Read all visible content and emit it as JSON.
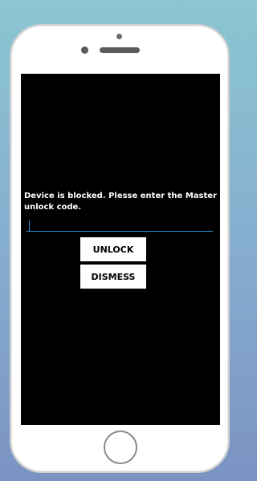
{
  "dialog": {
    "message": "Device is blocked. Plesse enter the Master unlock code.",
    "code_value": "",
    "unlock_label": "UNLOCK",
    "dismiss_label": "DISMESS"
  },
  "colors": {
    "background_top": "#8cc6d2",
    "background_bottom": "#7b93c3",
    "screen": "#000000",
    "accent": "#2b8fd6"
  }
}
